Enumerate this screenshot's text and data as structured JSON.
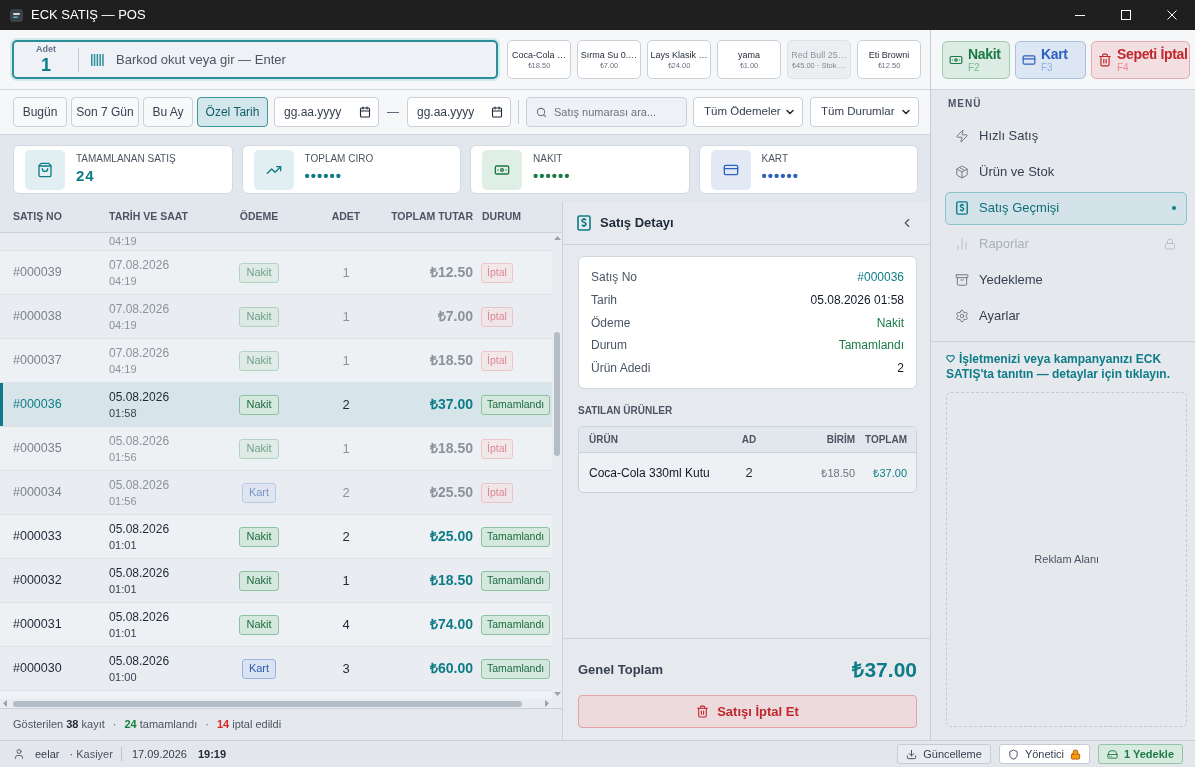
{
  "window": {
    "title": "ECK SATIŞ — POS"
  },
  "barcode": {
    "quantity_label": "Adet",
    "quantity": "1",
    "placeholder": "Barkod okut veya gir — Enter"
  },
  "quick_products": [
    {
      "name": "Coca-Cola …",
      "price": "₺18.50",
      "disabled": false
    },
    {
      "name": "Sırma Su 0.…",
      "price": "₺7.00",
      "disabled": false
    },
    {
      "name": "Lays Klasik …",
      "price": "₺24.00",
      "disabled": false
    },
    {
      "name": "yama",
      "price": "₺1.00",
      "disabled": false
    },
    {
      "name": "Red Bull 25…",
      "price": "₺45.00 · Stok …",
      "disabled": true
    },
    {
      "name": "Eti Browni",
      "price": "₺12.50",
      "disabled": false
    }
  ],
  "payment_buttons": [
    {
      "kind": "cash",
      "label": "Nakit",
      "shortcut": "F2"
    },
    {
      "kind": "card",
      "label": "Kart",
      "shortcut": "F3"
    },
    {
      "kind": "cancel",
      "label": "Sepeti İptal",
      "shortcut": "F4"
    }
  ],
  "filters": {
    "ranges": [
      {
        "label": "Bugün",
        "selected": false
      },
      {
        "label": "Son 7 Gün",
        "selected": false
      },
      {
        "label": "Bu Ay",
        "selected": false
      },
      {
        "label": "Özel Tarih",
        "selected": true
      }
    ],
    "date_from": {
      "placeholder": "gg.aa.yyyy"
    },
    "date_separator": "—",
    "date_to": {
      "placeholder": "gg.aa.yyyy"
    },
    "search": {
      "placeholder": "Satış numarası ara..."
    },
    "payment_select": "Tüm Ödemeler",
    "status_select": "Tüm Durumlar"
  },
  "stats": [
    {
      "kind": "sales",
      "label": "TAMAMLANAN SATIŞ",
      "value": "24"
    },
    {
      "kind": "revenue",
      "label": "TOPLAM CIRO",
      "value": "••••••"
    },
    {
      "kind": "cash",
      "label": "NAKIT",
      "value": "••••••"
    },
    {
      "kind": "card",
      "label": "KART",
      "value": "••••••"
    }
  ],
  "sales_table": {
    "columns": [
      "SATIŞ NO",
      "TARİH VE SAAT",
      "ÖDEME",
      "ADET",
      "TOPLAM TUTAR",
      "DURUM"
    ],
    "partial_row": {
      "time": "04:19"
    },
    "rows": [
      {
        "number": "#000039",
        "date": "07.08.2026",
        "time": "04:19",
        "payment": {
          "kind": "cash",
          "label": "Nakit"
        },
        "quantity": "1",
        "total": "₺12.50",
        "status": {
          "kind": "cancelled",
          "label": "İptal"
        },
        "selected": false
      },
      {
        "number": "#000038",
        "date": "07.08.2026",
        "time": "04:19",
        "payment": {
          "kind": "cash",
          "label": "Nakit"
        },
        "quantity": "1",
        "total": "₺7.00",
        "status": {
          "kind": "cancelled",
          "label": "İptal"
        },
        "selected": false
      },
      {
        "number": "#000037",
        "date": "07.08.2026",
        "time": "04:19",
        "payment": {
          "kind": "cash",
          "label": "Nakit"
        },
        "quantity": "1",
        "total": "₺18.50",
        "status": {
          "kind": "cancelled",
          "label": "İptal"
        },
        "selected": false
      },
      {
        "number": "#000036",
        "date": "05.08.2026",
        "time": "01:58",
        "payment": {
          "kind": "cash",
          "label": "Nakit"
        },
        "quantity": "2",
        "total": "₺37.00",
        "status": {
          "kind": "completed",
          "label": "Tamamlandı"
        },
        "selected": true
      },
      {
        "number": "#000035",
        "date": "05.08.2026",
        "time": "01:56",
        "payment": {
          "kind": "cash",
          "label": "Nakit"
        },
        "quantity": "1",
        "total": "₺18.50",
        "status": {
          "kind": "cancelled",
          "label": "İptal"
        },
        "selected": false
      },
      {
        "number": "#000034",
        "date": "05.08.2026",
        "time": "01:56",
        "payment": {
          "kind": "card",
          "label": "Kart"
        },
        "quantity": "2",
        "total": "₺25.50",
        "status": {
          "kind": "cancelled",
          "label": "İptal"
        },
        "selected": false
      },
      {
        "number": "#000033",
        "date": "05.08.2026",
        "time": "01:01",
        "payment": {
          "kind": "cash",
          "label": "Nakit"
        },
        "quantity": "2",
        "total": "₺25.00",
        "status": {
          "kind": "completed",
          "label": "Tamamlandı"
        },
        "selected": false
      },
      {
        "number": "#000032",
        "date": "05.08.2026",
        "time": "01:01",
        "payment": {
          "kind": "cash",
          "label": "Nakit"
        },
        "quantity": "1",
        "total": "₺18.50",
        "status": {
          "kind": "completed",
          "label": "Tamamlandı"
        },
        "selected": false
      },
      {
        "number": "#000031",
        "date": "05.08.2026",
        "time": "01:01",
        "payment": {
          "kind": "cash",
          "label": "Nakit"
        },
        "quantity": "4",
        "total": "₺74.00",
        "status": {
          "kind": "completed",
          "label": "Tamamlandı"
        },
        "selected": false
      },
      {
        "number": "#000030",
        "date": "05.08.2026",
        "time": "01:00",
        "payment": {
          "kind": "card",
          "label": "Kart"
        },
        "quantity": "3",
        "total": "₺60.00",
        "status": {
          "kind": "completed",
          "label": "Tamamlandı"
        },
        "selected": false
      }
    ]
  },
  "summary": [
    {
      "kind": "total",
      "text": "Gösterilen **38** kayıt"
    },
    {
      "kind": "separator",
      "text": "·"
    },
    {
      "kind": "completed",
      "text": "**24** tamamlandı"
    },
    {
      "kind": "separator",
      "text": "·"
    },
    {
      "kind": "cancelled",
      "text": "**14** iptal edildi"
    }
  ],
  "detail": {
    "title": "Satış Detayı",
    "fields": [
      {
        "kind": "number",
        "label": "Satış No",
        "value": "#000036"
      },
      {
        "kind": "date",
        "label": "Tarih",
        "value": "05.08.2026 01:58"
      },
      {
        "kind": "payment",
        "label": "Ödeme",
        "value": "Nakit"
      },
      {
        "kind": "status",
        "label": "Durum",
        "value": "Tamamlandı"
      },
      {
        "kind": "count",
        "label": "Ürün Adedi",
        "value": "2"
      }
    ],
    "items_title": "SATILAN ÜRÜNLER",
    "item_columns": [
      "ÜRÜN",
      "AD",
      "BİRİM",
      "TOPLAM"
    ],
    "items": [
      {
        "name": "Coca-Cola 330ml Kutu",
        "quantity": "2",
        "unit_price": "₺18.50",
        "total": "₺37.00"
      }
    ],
    "grand_total_label": "Genel Toplam",
    "grand_total": "₺37.00",
    "cancel_label": "Satışı İptal Et"
  },
  "menu": {
    "title": "MENÜ",
    "items": [
      {
        "label": "Hızlı Satış",
        "selected": false,
        "disabled": false
      },
      {
        "label": "Ürün ve Stok",
        "selected": false,
        "disabled": false
      },
      {
        "label": "Satış Geçmişi",
        "selected": true,
        "disabled": false
      },
      {
        "label": "Raporlar",
        "selected": false,
        "disabled": true
      },
      {
        "label": "Yedekleme",
        "selected": false,
        "disabled": false
      },
      {
        "label": "Ayarlar",
        "selected": false,
        "disabled": false
      }
    ]
  },
  "promo": {
    "text": "İşletmenizi veya kampanyanızı ECK SATIŞ'ta tanıtın — detaylar için tıklayın."
  },
  "ad": {
    "label": "Reklam Alanı"
  },
  "status_bar": {
    "user": "eelar",
    "role": "· Kasiyer",
    "date": "17.09.2026",
    "time": "19:19",
    "buttons": [
      {
        "kind": "update",
        "label": "Güncelleme"
      },
      {
        "kind": "admin",
        "label": "Yönetici"
      },
      {
        "kind": "backup",
        "label": "1 Yedekle"
      }
    ]
  }
}
